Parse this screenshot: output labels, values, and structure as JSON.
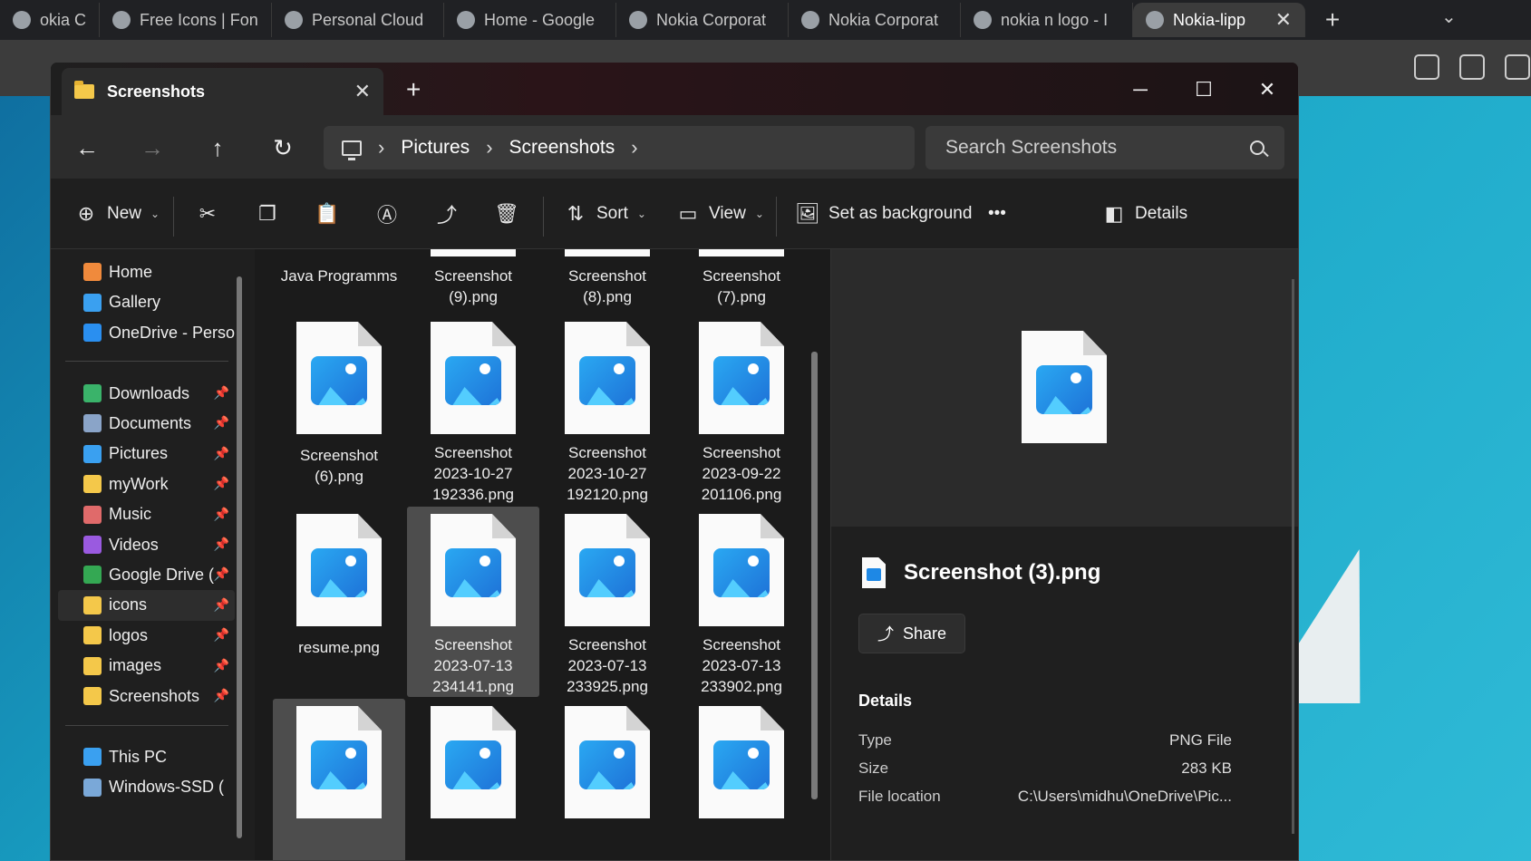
{
  "browser": {
    "tabs": [
      {
        "label": "okia Corporat",
        "active": false
      },
      {
        "label": "Free Icons | Fon",
        "active": false
      },
      {
        "label": "Personal Cloud",
        "active": false
      },
      {
        "label": "Home - Google",
        "active": false
      },
      {
        "label": "Nokia Corporat",
        "active": false
      },
      {
        "label": "Nokia Corporat",
        "active": false
      },
      {
        "label": "nokia n logo - I",
        "active": false
      },
      {
        "label": "Nokia-lipp",
        "active": true
      }
    ],
    "new_tab": "+",
    "tab_list": "⌄"
  },
  "explorer": {
    "tab_title": "Screenshots",
    "tab_close": "✕",
    "new_tab": "+",
    "window": {
      "minimize": "─",
      "maximize": "☐",
      "close": "✕"
    },
    "nav": {
      "back": "←",
      "forward": "→",
      "up": "↑",
      "refresh": "↻"
    },
    "breadcrumb": [
      "Pictures",
      "Screenshots"
    ],
    "crumb_sep": "›",
    "search_placeholder": "Search Screenshots",
    "commands": {
      "new": "New",
      "sort": "Sort",
      "view": "View",
      "set_background": "Set as background",
      "more": "•••",
      "details": "Details"
    },
    "sidebar": {
      "quick": [
        {
          "label": "Home",
          "icon": "home-icon",
          "color": "#f08a3c"
        },
        {
          "label": "Gallery",
          "icon": "gallery-icon",
          "color": "#3aa0f0"
        },
        {
          "label": "OneDrive - Persor",
          "icon": "onedrive-icon",
          "color": "#2a8ff0"
        }
      ],
      "pinned": [
        {
          "label": "Downloads",
          "icon": "downloads-icon",
          "color": "#3ab36a"
        },
        {
          "label": "Documents",
          "icon": "documents-icon",
          "color": "#8aa4c8"
        },
        {
          "label": "Pictures",
          "icon": "pictures-icon",
          "color": "#3aa0f0"
        },
        {
          "label": "myWork",
          "icon": "folder-icon",
          "color": "#f4c84a"
        },
        {
          "label": "Music",
          "icon": "music-icon",
          "color": "#e06a6a"
        },
        {
          "label": "Videos",
          "icon": "videos-icon",
          "color": "#9a5ae0"
        },
        {
          "label": "Google Drive (",
          "icon": "google-drive-icon",
          "color": "#34a853"
        },
        {
          "label": "icons",
          "icon": "folder-icon",
          "color": "#f4c84a",
          "selected": true
        },
        {
          "label": "logos",
          "icon": "folder-icon",
          "color": "#f4c84a"
        },
        {
          "label": "images",
          "icon": "folder-icon",
          "color": "#f4c84a"
        },
        {
          "label": "Screenshots",
          "icon": "folder-icon",
          "color": "#f4c84a"
        }
      ],
      "pc": [
        {
          "label": "This PC",
          "icon": "this-pc-icon",
          "color": "#3aa0f0"
        },
        {
          "label": "Windows-SSD (",
          "icon": "drive-icon",
          "color": "#7aa8d8"
        }
      ],
      "pin_glyph": "📌"
    },
    "files": {
      "row0": [
        "Java Programms",
        "Screenshot\n(9).png",
        "Screenshot\n(8).png",
        "Screenshot\n(7).png"
      ],
      "row1": [
        "Screenshot\n(6).png",
        "Screenshot\n2023-10-27\n192336.png",
        "Screenshot\n2023-10-27\n192120.png",
        "Screenshot\n2023-09-22\n201106.png"
      ],
      "row2": [
        "resume.png",
        "Screenshot\n2023-07-13\n234141.png",
        "Screenshot\n2023-07-13\n233925.png",
        "Screenshot\n2023-07-13\n233902.png"
      ]
    },
    "details_pane": {
      "file_name": "Screenshot (3).png",
      "share": "Share",
      "heading": "Details",
      "rows": [
        {
          "key": "Type",
          "value": "PNG File"
        },
        {
          "key": "Size",
          "value": "283 KB"
        },
        {
          "key": "File location",
          "value": "C:\\Users\\midhu\\OneDrive\\Pic..."
        }
      ]
    }
  }
}
